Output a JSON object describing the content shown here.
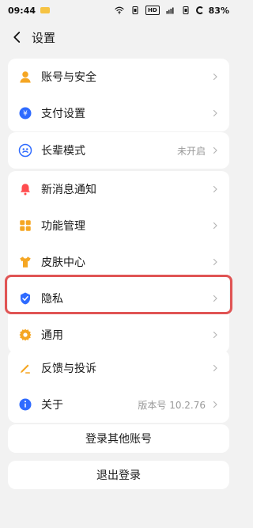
{
  "status_bar": {
    "time": "09:44",
    "mini_tag": "HD",
    "battery": "83%"
  },
  "header": {
    "title": "设置"
  },
  "groups": [
    {
      "items": [
        {
          "label": "账号与安全",
          "icon": "user-icon",
          "value": ""
        },
        {
          "label": "支付设置",
          "icon": "yuan-icon",
          "value": ""
        }
      ]
    },
    {
      "items": [
        {
          "label": "长辈模式",
          "icon": "elder-mode-icon",
          "value": "未开启"
        }
      ]
    },
    {
      "items": [
        {
          "label": "新消息通知",
          "icon": "bell-icon",
          "value": ""
        },
        {
          "label": "功能管理",
          "icon": "grid-icon",
          "value": ""
        },
        {
          "label": "皮肤中心",
          "icon": "tshirt-icon",
          "value": ""
        },
        {
          "label": "隐私",
          "icon": "shield-check-icon",
          "value": ""
        },
        {
          "label": "通用",
          "icon": "gear-icon",
          "value": ""
        }
      ]
    },
    {
      "items": [
        {
          "label": "反馈与投诉",
          "icon": "feedback-icon",
          "value": ""
        },
        {
          "label": "关于",
          "icon": "info-icon",
          "value": "版本号 10.2.76"
        }
      ]
    }
  ],
  "buttons": {
    "login_other": "登录其他账号",
    "logout": "退出登录"
  },
  "colors": {
    "background": "#f2f2f2",
    "card": "#ffffff",
    "accent_blue": "#2f6bff",
    "accent_orange": "#f5a623",
    "accent_red": "#ff4d4f",
    "highlight_red": "#e05454"
  }
}
